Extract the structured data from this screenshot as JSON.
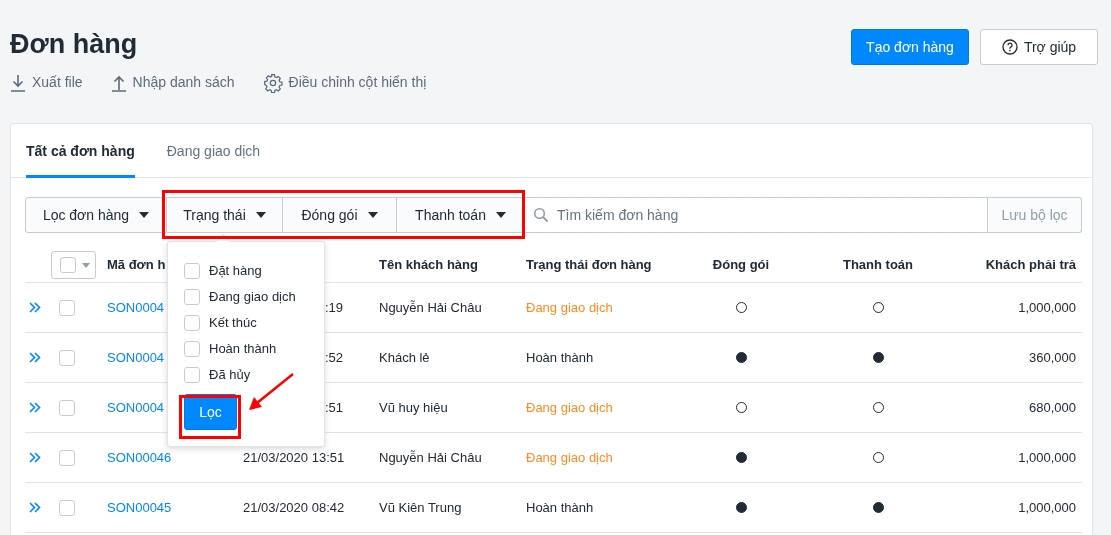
{
  "page_title": "Đơn hàng",
  "actions": [
    {
      "kind": "download",
      "label": "Xuất file"
    },
    {
      "kind": "upload",
      "label": "Nhập danh sách"
    },
    {
      "kind": "settings",
      "label": "Điều chỉnh cột hiển thị"
    }
  ],
  "buttons": [
    {
      "kind": "primary",
      "label": "Tạo đơn hàng"
    },
    {
      "kind": "help",
      "label": "Trợ giúp"
    }
  ],
  "tabs": [
    {
      "label": "Tất cả đơn hàng",
      "selected": true
    },
    {
      "label": "Đang giao dịch",
      "selected": false
    }
  ],
  "filters": [
    {
      "label": "Lọc đơn hàng"
    },
    {
      "label": "Trạng thái"
    },
    {
      "label": "Đóng gói"
    },
    {
      "label": "Thanh toán"
    }
  ],
  "search": {
    "placeholder": "Tìm kiếm đơn hàng"
  },
  "save_filter": "Lưu bộ lọc",
  "dropdown": {
    "options": [
      {
        "label": "Đặt hàng",
        "checked": false
      },
      {
        "label": "Đang giao dịch",
        "checked": false
      },
      {
        "label": "Kết thúc",
        "checked": false
      },
      {
        "label": "Hoàn thành",
        "checked": false
      },
      {
        "label": "Đã hủy",
        "checked": false
      }
    ],
    "apply_button": "Lọc"
  },
  "table": {
    "select_all": {
      "checked": false
    },
    "columns": [
      "Mã đơn h",
      "Tên khách hàng",
      "Trạng thái đơn hàng",
      "Đóng gói",
      "Thanh toán",
      "Khách phải trả"
    ],
    "rows": [
      {
        "checked": false,
        "code": "SON0004",
        "date": ":19",
        "customer": "Nguyễn Hải Châu",
        "status": "Đang giao dịch",
        "color": "#ff8a1f",
        "packed": false,
        "paid": false,
        "total": "1,000,000"
      },
      {
        "checked": false,
        "code": "SON0004",
        "date": ":52",
        "customer": "Khách lẻ",
        "status": "Hoàn thành",
        "color": "#212b36",
        "packed": true,
        "paid": true,
        "total": "360,000"
      },
      {
        "checked": false,
        "code": "SON0004",
        "date": ":51",
        "customer": "Vũ huy hiệu",
        "status": "Đang giao dịch",
        "color": "#ff8a1f",
        "packed": false,
        "paid": false,
        "total": "680,000"
      },
      {
        "checked": false,
        "code": "SON00046",
        "date": "21/03/2020 13:51",
        "customer": "Nguyễn Hải Châu",
        "status": "Đang giao dịch",
        "color": "#ff8a1f",
        "packed": true,
        "paid": false,
        "total": "1,000,000"
      },
      {
        "checked": false,
        "code": "SON00045",
        "date": "21/03/2020 08:42",
        "customer": "Vũ Kiên Trung",
        "status": "Hoàn thành",
        "color": "#212b36",
        "packed": true,
        "paid": true,
        "total": "1,000,000"
      }
    ]
  }
}
